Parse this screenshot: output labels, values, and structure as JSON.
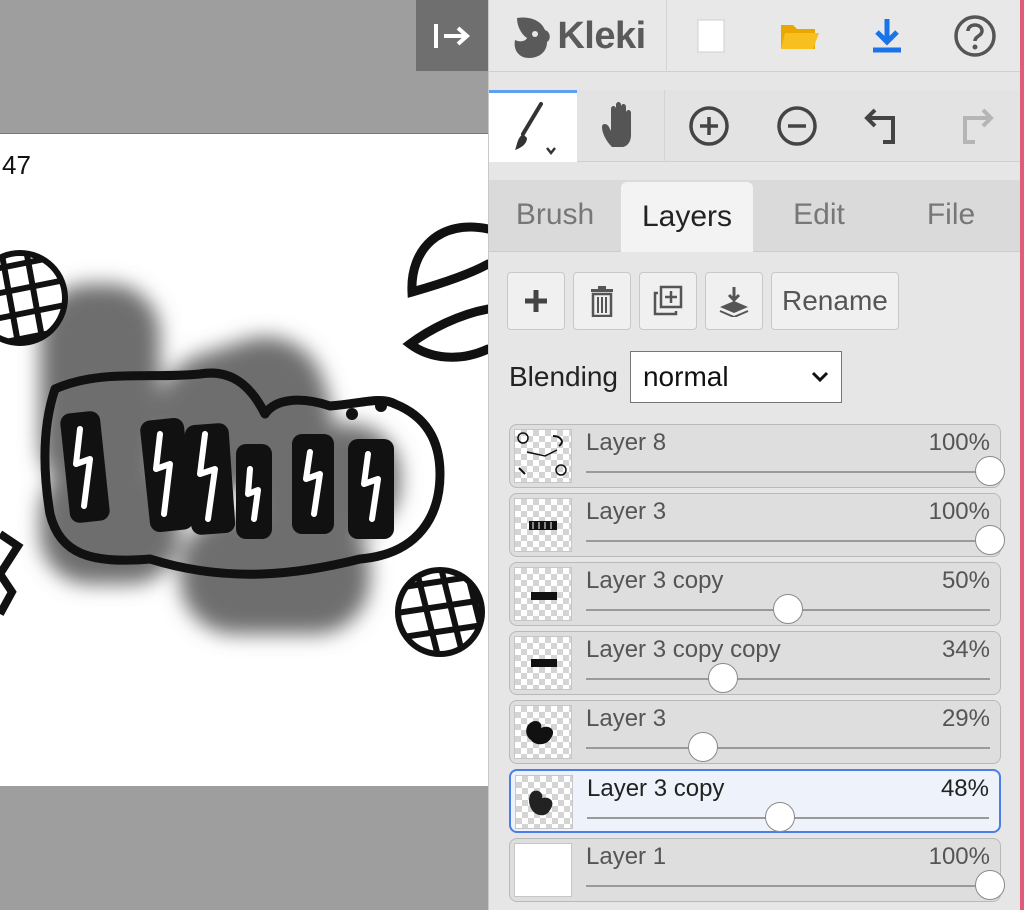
{
  "canvas": {
    "label": "47"
  },
  "app": {
    "name": "Kleki"
  },
  "tabs": [
    {
      "label": "Brush",
      "active": false
    },
    {
      "label": "Layers",
      "active": true
    },
    {
      "label": "Edit",
      "active": false
    },
    {
      "label": "File",
      "active": false
    }
  ],
  "layer_actions": {
    "rename_label": "Rename"
  },
  "blending": {
    "label": "Blending",
    "value": "normal"
  },
  "layers": [
    {
      "name": "Layer 8",
      "opacity": "100%",
      "opacity_value": 100,
      "selected": false
    },
    {
      "name": "Layer 3",
      "opacity": "100%",
      "opacity_value": 100,
      "selected": false
    },
    {
      "name": "Layer 3 copy",
      "opacity": "50%",
      "opacity_value": 50,
      "selected": false
    },
    {
      "name": "Layer 3 copy copy",
      "opacity": "34%",
      "opacity_value": 34,
      "selected": false
    },
    {
      "name": "Layer 3",
      "opacity": "29%",
      "opacity_value": 29,
      "selected": false
    },
    {
      "name": "Layer 3 copy",
      "opacity": "48%",
      "opacity_value": 48,
      "selected": true
    },
    {
      "name": "Layer 1",
      "opacity": "100%",
      "opacity_value": 100,
      "selected": false
    }
  ],
  "colors": {
    "accent": "#4b7ee6",
    "download": "#1a73e8",
    "folder": "#f5b400",
    "edge": "#e05d7a"
  }
}
